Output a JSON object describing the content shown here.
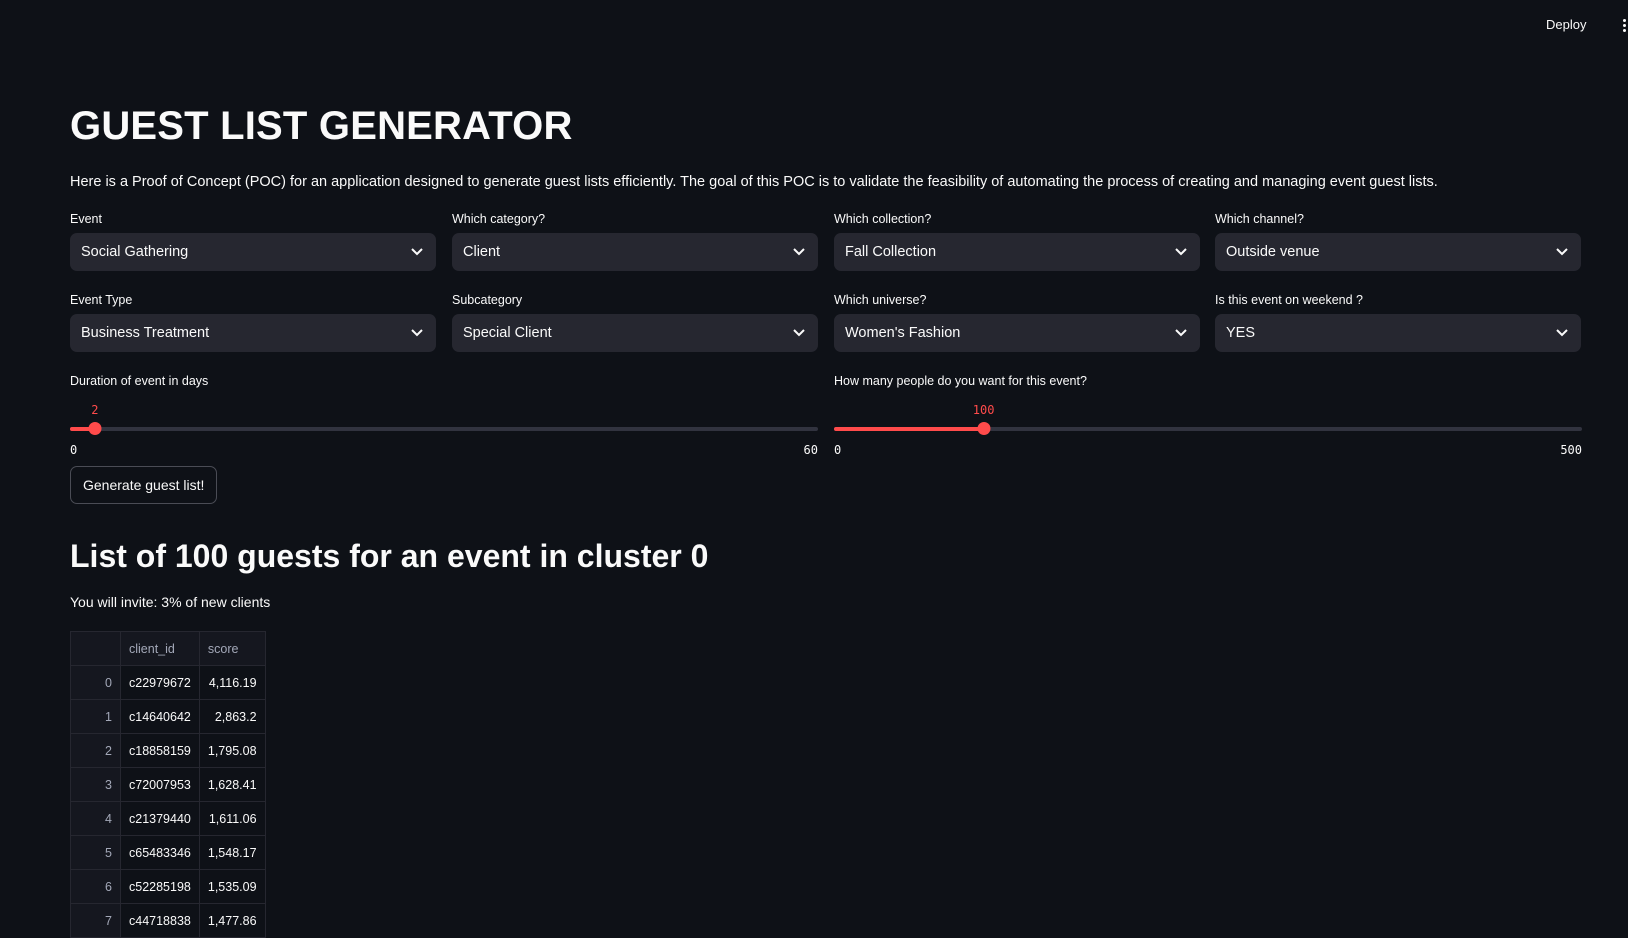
{
  "topbar": {
    "deploy_label": "Deploy"
  },
  "page": {
    "title": "GUEST LIST GENERATOR",
    "intro": "Here is a Proof of Concept (POC) for an application designed to generate guest lists efficiently. The goal of this POC is to validate the feasibility of automating the process of creating and managing event guest lists."
  },
  "selects": [
    {
      "label": "Event",
      "value": "Social Gathering"
    },
    {
      "label": "Which category?",
      "value": "Client"
    },
    {
      "label": "Which collection?",
      "value": "Fall Collection"
    },
    {
      "label": "Which channel?",
      "value": "Outside venue"
    },
    {
      "label": "Event Type",
      "value": "Business Treatment"
    },
    {
      "label": "Subcategory",
      "value": "Special Client"
    },
    {
      "label": "Which universe?",
      "value": "Women's Fashion"
    },
    {
      "label": "Is this event on weekend ?",
      "value": "YES"
    }
  ],
  "sliders": [
    {
      "label": "Duration of event in days",
      "value": 2,
      "value_text": "2",
      "min": 0,
      "max": 60,
      "min_text": "0",
      "max_text": "60"
    },
    {
      "label": "How many people do you want for this event?",
      "value": 100,
      "value_text": "100",
      "min": 0,
      "max": 500,
      "min_text": "0",
      "max_text": "500"
    }
  ],
  "generate_button": "Generate guest list!",
  "result": {
    "heading": "List of 100 guests for an event in cluster 0",
    "invite_text": "You will invite: 3% of new clients"
  },
  "table": {
    "columns": [
      "",
      "client_id",
      "score"
    ],
    "rows": [
      [
        "0",
        "c22979672",
        "4,116.19"
      ],
      [
        "1",
        "c14640642",
        "2,863.2"
      ],
      [
        "2",
        "c18858159",
        "1,795.08"
      ],
      [
        "3",
        "c72007953",
        "1,628.41"
      ],
      [
        "4",
        "c21379440",
        "1,611.06"
      ],
      [
        "5",
        "c65483346",
        "1,548.17"
      ],
      [
        "6",
        "c52285198",
        "1,535.09"
      ],
      [
        "7",
        "c44718838",
        "1,477.86"
      ]
    ]
  },
  "colors": {
    "accent": "#ff4b4b",
    "background": "#0e1117",
    "input_bg": "#262730"
  }
}
